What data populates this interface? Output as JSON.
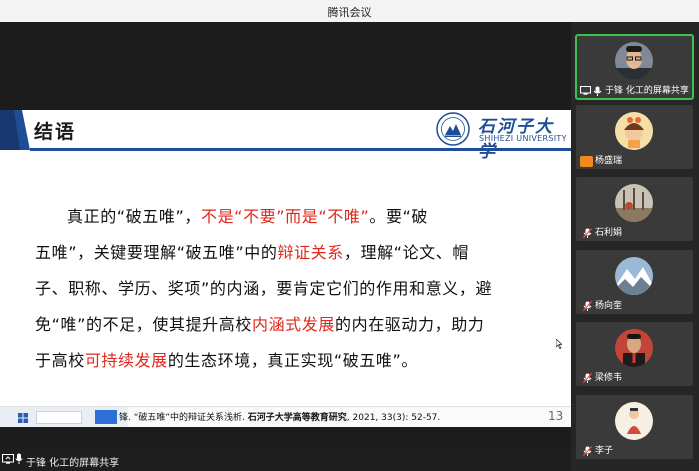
{
  "window": {
    "title": "腾讯会议"
  },
  "slide": {
    "title": "结语",
    "logo": {
      "name_cn": "石河子大学",
      "name_en": "SHIHEZI UNIVERSITY"
    },
    "lines": [
      {
        "segments": [
          {
            "text": "真正的“破五唯”，",
            "color": "black"
          },
          {
            "text": "不是“不要”而是“不唯”",
            "color": "red"
          },
          {
            "text": "。要“破",
            "color": "black"
          }
        ]
      },
      {
        "segments": [
          {
            "text": "五唯”，关键要理解“破五唯”中的",
            "color": "black"
          },
          {
            "text": "辩证关系",
            "color": "red"
          },
          {
            "text": "，理解“论文、帽",
            "color": "black"
          }
        ]
      },
      {
        "segments": [
          {
            "text": "子、职称、学历、奖项”的内涵，要肯定它们的作用和意义，避",
            "color": "black"
          }
        ]
      },
      {
        "segments": [
          {
            "text": "免“唯”的不足，使其提升高校",
            "color": "black"
          },
          {
            "text": "内涵式发展",
            "color": "red"
          },
          {
            "text": "的内在驱动力，助力",
            "color": "black"
          }
        ]
      },
      {
        "segments": [
          {
            "text": "于高校",
            "color": "black"
          },
          {
            "text": "可持续发展",
            "color": "red"
          },
          {
            "text": "的生态环境，真正实现“破五唯”。",
            "color": "black"
          }
        ]
      }
    ],
    "citation_prefix": "锋. “破五唯”中的辩证关系浅析. ",
    "citation_journal": "石河子大学高等教育研究",
    "citation_suffix": ", 2021, 33(3): 52-57.",
    "page_number": "13"
  },
  "statusbar": {
    "sharer": "于锋 化工的屏幕共享"
  },
  "participants": [
    {
      "name": "于锋 化工的屏幕共享",
      "mic": "on",
      "sharing": true,
      "active": true,
      "avatar": "man-glasses"
    },
    {
      "name": "杨盛瑞",
      "mic": "none",
      "sharing": false,
      "active": false,
      "avatar": "cartoon-girl"
    },
    {
      "name": "石利娟",
      "mic": "muted",
      "sharing": false,
      "active": false,
      "avatar": "winter-trees"
    },
    {
      "name": "杨向奎",
      "mic": "muted",
      "sharing": false,
      "active": false,
      "avatar": "snow-mountain"
    },
    {
      "name": "梁修韦",
      "mic": "muted",
      "sharing": false,
      "active": false,
      "avatar": "man-suit-red"
    },
    {
      "name": "李子",
      "mic": "muted",
      "sharing": false,
      "active": false,
      "avatar": "drawing-figure"
    }
  ],
  "colors": {
    "accent_red": "#e0271c",
    "brand_blue": "#1f4e96",
    "active_green": "#3fbf4f"
  }
}
